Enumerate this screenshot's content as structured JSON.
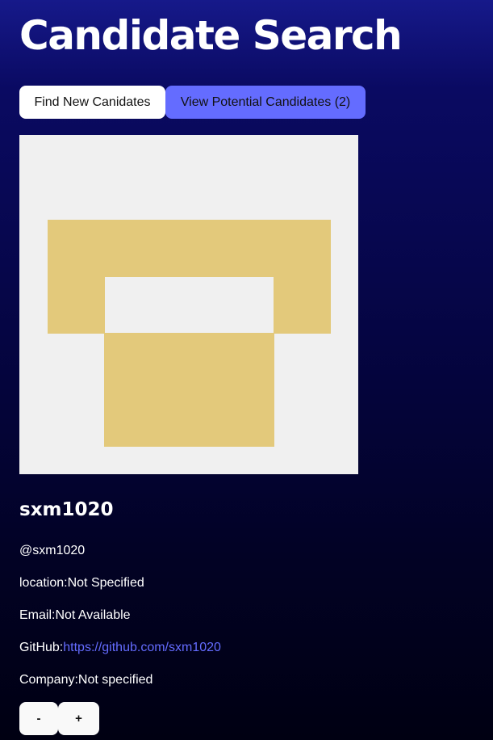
{
  "header": {
    "title": "Candidate Search"
  },
  "nav": {
    "find_label": "Find New Canidates",
    "view_label": "View Potential Candidates (2)"
  },
  "candidate": {
    "avatar": "identicon-avatar",
    "name": "sxm1020",
    "handle": "@sxm1020",
    "location_label": "location:",
    "location": "Not Specified",
    "email_label": "Email:",
    "email": "Not Available",
    "github_label": "GitHub:",
    "github_url": "https://github.com/sxm1020",
    "company_label": "Company:",
    "company": "Not specified"
  },
  "actions": {
    "reject_label": "-",
    "accept_label": "+"
  },
  "colors": {
    "accent": "#646cff",
    "avatar_fill": "#e3c97b",
    "avatar_bg": "#f0f0f0"
  }
}
